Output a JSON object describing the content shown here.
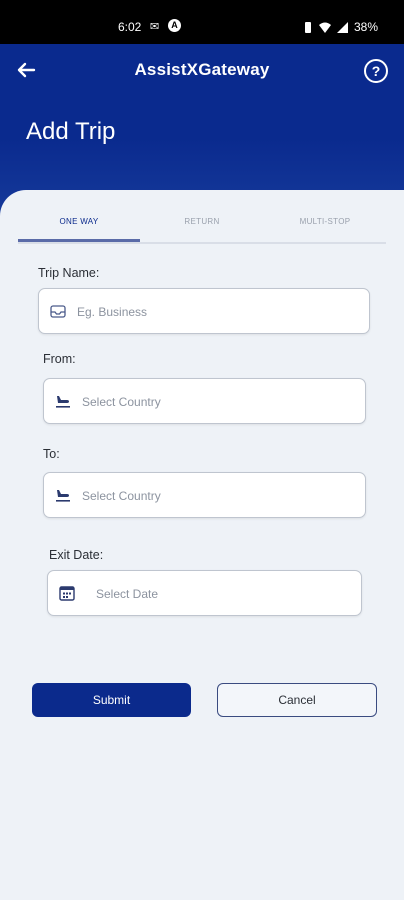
{
  "status_bar": {
    "time": "6:02",
    "battery": "38%"
  },
  "header": {
    "title": "AssistXGateway",
    "page_title": "Add Trip",
    "help_symbol": "?"
  },
  "tabs": [
    {
      "label": "ONE WAY",
      "active": true
    },
    {
      "label": "RETURN",
      "active": false
    },
    {
      "label": "MULTI-STOP",
      "active": false
    }
  ],
  "form": {
    "trip_name": {
      "label": "Trip Name:",
      "placeholder": "Eg. Business"
    },
    "from": {
      "label": "From:",
      "placeholder": "Select Country"
    },
    "to": {
      "label": "To:",
      "placeholder": "Select Country"
    },
    "exit_date": {
      "label": "Exit Date:",
      "placeholder": "Select Date"
    }
  },
  "buttons": {
    "submit": "Submit",
    "cancel": "Cancel"
  },
  "colors": {
    "primary": "#0b2a8c",
    "background": "#eef2f7"
  }
}
